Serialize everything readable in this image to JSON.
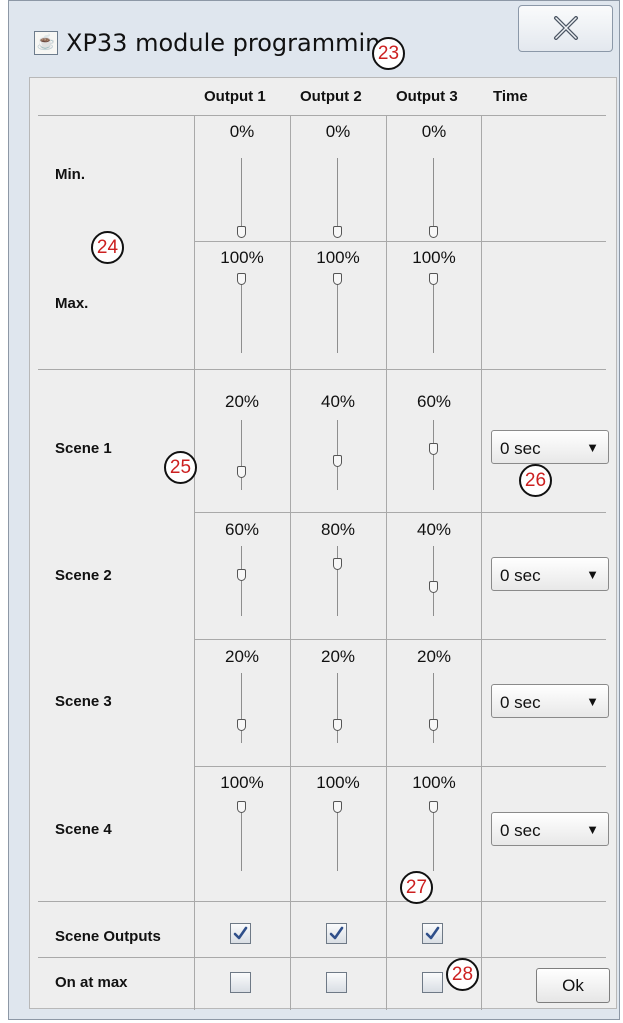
{
  "window": {
    "title": "XP33 module programming",
    "icon": "java-icon",
    "close_icon": "close-icon"
  },
  "columns": [
    "Output 1",
    "Output 2",
    "Output 3",
    "Time"
  ],
  "rows": [
    {
      "label": "Min.",
      "values": [
        "0%",
        "0%",
        "0%"
      ],
      "levels": [
        0,
        0,
        0
      ]
    },
    {
      "label": "Max.",
      "values": [
        "100%",
        "100%",
        "100%"
      ],
      "levels": [
        100,
        100,
        100
      ]
    },
    {
      "label": "Scene 1",
      "values": [
        "20%",
        "40%",
        "60%"
      ],
      "levels": [
        20,
        40,
        60
      ],
      "time": "0 sec"
    },
    {
      "label": "Scene 2",
      "values": [
        "60%",
        "80%",
        "40%"
      ],
      "levels": [
        60,
        80,
        40
      ],
      "time": "0 sec"
    },
    {
      "label": "Scene 3",
      "values": [
        "20%",
        "20%",
        "20%"
      ],
      "levels": [
        20,
        20,
        20
      ],
      "time": "0 sec"
    },
    {
      "label": "Scene 4",
      "values": [
        "100%",
        "100%",
        "100%"
      ],
      "levels": [
        100,
        100,
        100
      ],
      "time": "0 sec"
    }
  ],
  "scene_outputs": {
    "label": "Scene Outputs",
    "checked": [
      true,
      true,
      true
    ]
  },
  "on_at_max": {
    "label": "On at max",
    "checked": [
      false,
      false,
      false
    ]
  },
  "ok_label": "Ok",
  "callouts": [
    "23",
    "24",
    "25",
    "26",
    "27",
    "28"
  ],
  "colors": {
    "callout_text": "#cc2020",
    "window_frame": "#dfe6ee",
    "panel": "#eeeeee"
  }
}
